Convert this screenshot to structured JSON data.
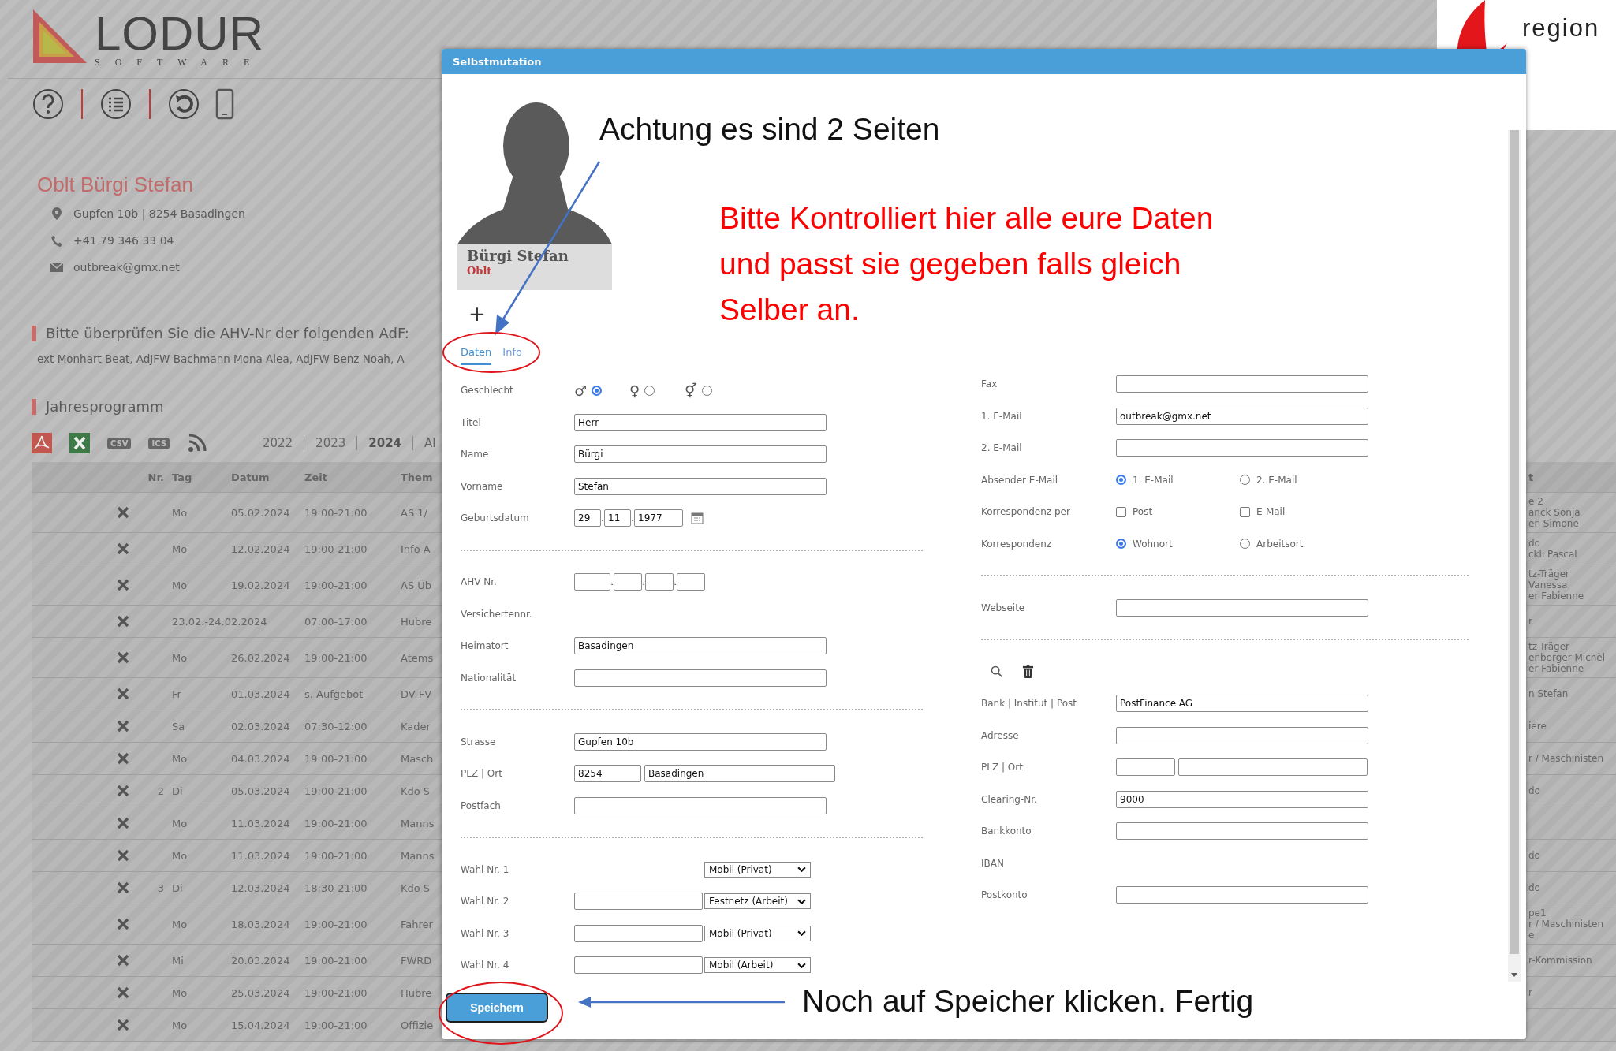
{
  "background": {
    "logo": {
      "name": "LODUR",
      "tagline": "SOFTWARE"
    },
    "profile": {
      "name": "Oblt Bürgi Stefan",
      "address": "Gupfen 10b | 8254 Basadingen",
      "phone": "+41 79 346 33 04",
      "email": "outbreak@gmx.net"
    },
    "notice": {
      "title": "Bitte überprüfen Sie die AHV-Nr der folgenden AdF:",
      "text": "ext Monhart Beat, AdJFW Bachmann Mona Alea, AdJFW Benz Noah, A"
    },
    "program": {
      "title": "Jahresprogramm",
      "csv_label": "CSV",
      "ics_label": "ICS",
      "years": [
        {
          "label": "2022",
          "selected": false
        },
        {
          "label": "2023",
          "selected": false
        },
        {
          "label": "2024",
          "selected": true
        },
        {
          "label": "Al",
          "selected": false
        }
      ],
      "columns": [
        "Nr.",
        "Tag",
        "Datum",
        "Zeit",
        "Them"
      ],
      "right_column": "t",
      "rows": [
        {
          "kind": "day",
          "tag": "Mo",
          "datum": "05.02.2024",
          "zeit": "19:00-21:00",
          "thema": "AS 1/",
          "right": [
            "e 2",
            "anck Sonja",
            "en Simone"
          ]
        },
        {
          "kind": "day",
          "tag": "Mo",
          "datum": "12.02.2024",
          "zeit": "19:00-21:00",
          "thema": "Info A",
          "right": [
            "do",
            "ckli Pascal"
          ]
        },
        {
          "kind": "day",
          "tag": "Mo",
          "datum": "19.02.2024",
          "zeit": "19:00-21:00",
          "thema": "AS Üb",
          "right": [
            "tz-Träger",
            "Vanessa",
            "er Fabienne"
          ]
        },
        {
          "kind": "range",
          "datum": "23.02.-24.02.2024",
          "zeit": "07:00-17:00",
          "thema": "Hubre",
          "right": [
            "r"
          ]
        },
        {
          "kind": "day",
          "tag": "Mo",
          "datum": "26.02.2024",
          "zeit": "19:00-21:00",
          "thema": "Atems",
          "right": [
            "tz-Träger",
            "enberger Michèl",
            "er Fabienne"
          ]
        },
        {
          "kind": "day",
          "tag": "Fr",
          "datum": "01.03.2024",
          "zeit": "s. Aufgebot",
          "thema": "DV FV",
          "right": [
            "n Stefan"
          ]
        },
        {
          "kind": "day",
          "tag": "Sa",
          "datum": "02.03.2024",
          "zeit": "07:30-12:00",
          "thema": "Kader",
          "right": [
            "iere"
          ]
        },
        {
          "kind": "day",
          "tag": "Mo",
          "datum": "04.03.2024",
          "zeit": "19:00-21:00",
          "thema": "Masch",
          "right": [
            "r / Maschinisten"
          ]
        },
        {
          "kind": "day",
          "nr": "2",
          "tag": "Di",
          "datum": "05.03.2024",
          "zeit": "19:00-21:00",
          "thema": "Kdo S",
          "right": [
            "do"
          ]
        },
        {
          "kind": "day",
          "tag": "Mo",
          "datum": "11.03.2024",
          "zeit": "19:00-21:00",
          "thema": "Manns"
        },
        {
          "kind": "day",
          "tag": "Mo",
          "datum": "11.03.2024",
          "zeit": "19:00-21:00",
          "thema": "Manns",
          "right": [
            "do"
          ]
        },
        {
          "kind": "day",
          "nr": "3",
          "tag": "Di",
          "datum": "12.03.2024",
          "zeit": "18:30-21:00",
          "thema": "Kdo S",
          "right": [
            "do"
          ]
        },
        {
          "kind": "day",
          "tag": "Mo",
          "datum": "18.03.2024",
          "zeit": "19:00-21:00",
          "thema": "Fahrer",
          "right": [
            "pe1",
            "r / Maschinisten",
            "e"
          ]
        },
        {
          "kind": "day",
          "tag": "Mi",
          "datum": "20.03.2024",
          "zeit": "19:00-21:00",
          "thema": "FWRD",
          "right": [
            "r-Kommission"
          ]
        },
        {
          "kind": "day",
          "tag": "Mo",
          "datum": "25.03.2024",
          "zeit": "19:00-21:00",
          "thema": "Hubre",
          "right": [
            "r"
          ]
        },
        {
          "kind": "day",
          "tag": "Mo",
          "datum": "15.04.2024",
          "zeit": "19:00-21:00",
          "thema": "Offizie"
        }
      ]
    }
  },
  "corner_logo": {
    "text": "region"
  },
  "dialog": {
    "title": "Selbstmutation",
    "person": {
      "name": "Bürgi Stefan",
      "rank": "Oblt"
    },
    "add_label": "+",
    "tabs": [
      {
        "label": "Daten",
        "selected": true
      },
      {
        "label": "Info",
        "selected": false
      }
    ],
    "left": [
      {
        "kind": "gender",
        "label": "Geschlecht",
        "options": [
          {
            "symbol": "♂",
            "selected": true
          },
          {
            "symbol": "♀",
            "selected": false
          },
          {
            "symbol": "⚥",
            "selected": false
          }
        ]
      },
      {
        "kind": "text",
        "label": "Titel",
        "value": "Herr"
      },
      {
        "kind": "text",
        "label": "Name",
        "value": "Bürgi"
      },
      {
        "kind": "text",
        "label": "Vorname",
        "value": "Stefan"
      },
      {
        "kind": "date",
        "label": "Geburtsdatum",
        "parts": [
          "29",
          "11",
          "1977"
        ],
        "separator": "."
      },
      {
        "kind": "divider"
      },
      {
        "kind": "ahv",
        "label": "AHV Nr.",
        "separator": "."
      },
      {
        "kind": "label",
        "label": "Versichertennr."
      },
      {
        "kind": "text",
        "label": "Heimatort",
        "value": "Basadingen"
      },
      {
        "kind": "text",
        "label": "Nationalität"
      },
      {
        "kind": "divider"
      },
      {
        "kind": "text",
        "label": "Strasse",
        "value": "Gupfen 10b"
      },
      {
        "kind": "split",
        "label": "PLZ | Ort",
        "value": "8254",
        "value2": "Basadingen"
      },
      {
        "kind": "text",
        "label": "Postfach"
      },
      {
        "kind": "divider"
      },
      {
        "kind": "phone",
        "label": "Wahl Nr. 1",
        "has_input": false,
        "select": "Mobil (Privat)"
      },
      {
        "kind": "phone",
        "label": "Wahl Nr. 2",
        "has_input": true,
        "select": "Festnetz (Arbeit)"
      },
      {
        "kind": "phone",
        "label": "Wahl Nr. 3",
        "has_input": true,
        "select": "Mobil (Privat)"
      },
      {
        "kind": "phone",
        "label": "Wahl Nr. 4",
        "has_input": true,
        "select": "Mobil (Arbeit)"
      }
    ],
    "right": [
      {
        "kind": "text",
        "label": "Fax"
      },
      {
        "kind": "text",
        "label": "1. E-Mail",
        "value": "outbreak@gmx.net"
      },
      {
        "kind": "text",
        "label": "2. E-Mail"
      },
      {
        "kind": "radio",
        "label": "Absender E-Mail",
        "options": [
          {
            "label": "1. E-Mail",
            "selected": true
          },
          {
            "label": "2. E-Mail",
            "selected": false
          }
        ]
      },
      {
        "kind": "checkbox",
        "label": "Korrespondenz per",
        "options": [
          {
            "label": "Post",
            "checked": false
          },
          {
            "label": "E-Mail",
            "checked": false
          }
        ]
      },
      {
        "kind": "radio",
        "label": "Korrespondenz",
        "options": [
          {
            "label": "Wohnort",
            "selected": true
          },
          {
            "label": "Arbeitsort",
            "selected": false
          }
        ]
      },
      {
        "kind": "divider"
      },
      {
        "kind": "text",
        "label": "Webseite"
      },
      {
        "kind": "divider"
      },
      {
        "kind": "icons"
      },
      {
        "kind": "text",
        "label": "Bank | Institut | Post",
        "value": "PostFinance AG"
      },
      {
        "kind": "text",
        "label": "Adresse"
      },
      {
        "kind": "split",
        "label": "PLZ | Ort"
      },
      {
        "kind": "text",
        "label": "Clearing-Nr.",
        "value": "9000"
      },
      {
        "kind": "text",
        "label": "Bankkonto"
      },
      {
        "kind": "label",
        "label": "IBAN"
      },
      {
        "kind": "text",
        "label": "Postkonto"
      }
    ],
    "save_button": "Speichern"
  },
  "annotations": {
    "heading": "Achtung es sind 2 Seiten",
    "instruction_lines": [
      "Bitte Kontrolliert hier alle eure Daten",
      "und passt sie gegeben falls gleich",
      "Selber an."
    ],
    "footer_note": "Noch auf Speicher klicken. Fertig"
  }
}
